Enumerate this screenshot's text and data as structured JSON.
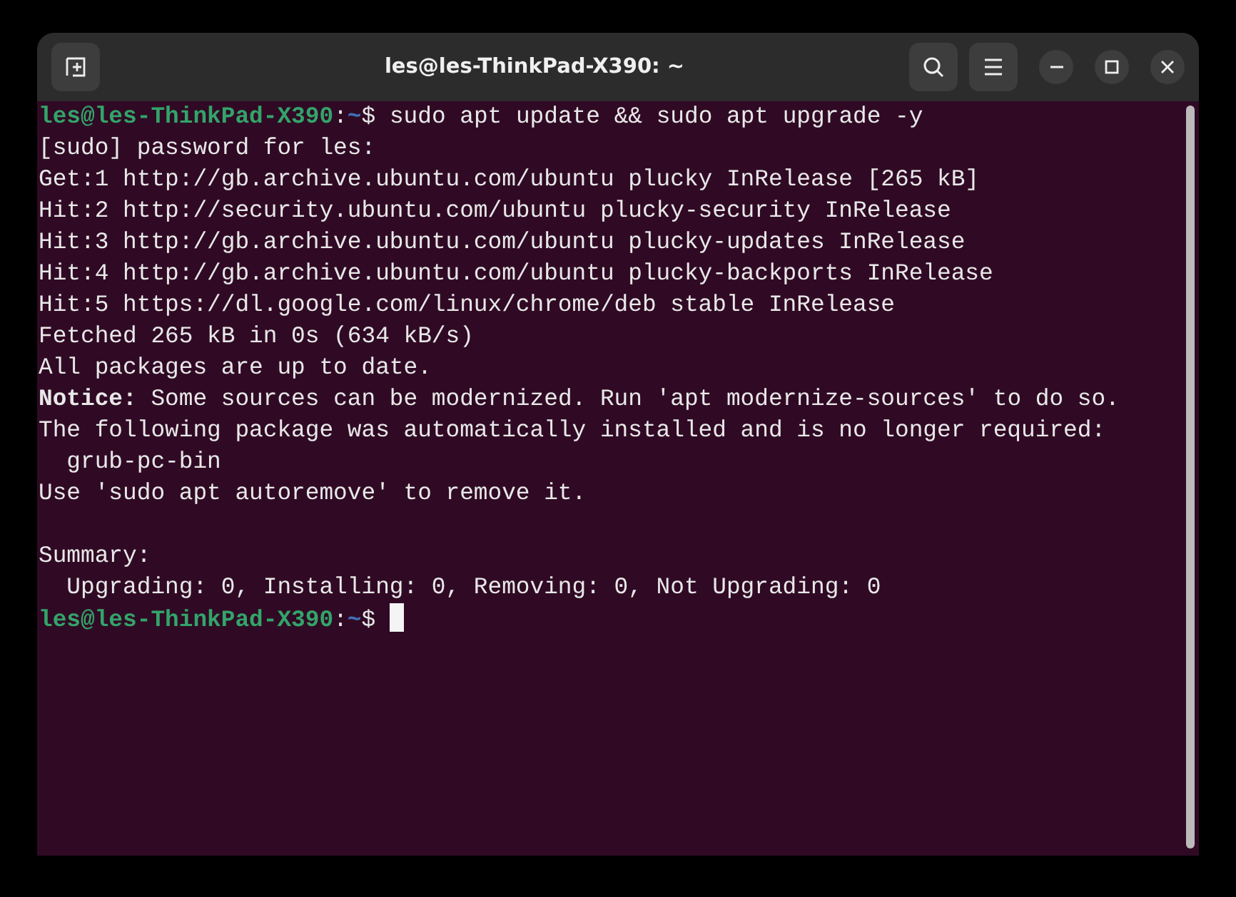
{
  "window": {
    "title": "les@les-ThinkPad-X390: ~"
  },
  "terminal": {
    "lines": [
      {
        "kind": "prompt",
        "user_host": "les@les-ThinkPad-X390",
        "separator": ":",
        "path": "~",
        "symbol": "$",
        "command": "sudo apt update && sudo apt upgrade -y",
        "cursor": false
      },
      {
        "kind": "output",
        "text": "[sudo] password for les:"
      },
      {
        "kind": "output",
        "text": "Get:1 http://gb.archive.ubuntu.com/ubuntu plucky InRelease [265 kB]"
      },
      {
        "kind": "output",
        "text": "Hit:2 http://security.ubuntu.com/ubuntu plucky-security InRelease"
      },
      {
        "kind": "output",
        "text": "Hit:3 http://gb.archive.ubuntu.com/ubuntu plucky-updates InRelease"
      },
      {
        "kind": "output",
        "text": "Hit:4 http://gb.archive.ubuntu.com/ubuntu plucky-backports InRelease"
      },
      {
        "kind": "output",
        "text": "Hit:5 https://dl.google.com/linux/chrome/deb stable InRelease"
      },
      {
        "kind": "output",
        "text": "Fetched 265 kB in 0s (634 kB/s)"
      },
      {
        "kind": "output",
        "text": "All packages are up to date."
      },
      {
        "kind": "output",
        "text": "**Notice:** Some sources can be modernized. Run 'apt modernize-sources' to do so."
      },
      {
        "kind": "output",
        "text": "The following package was automatically installed and is no longer required:"
      },
      {
        "kind": "output",
        "text": "  grub-pc-bin"
      },
      {
        "kind": "output",
        "text": "Use 'sudo apt autoremove' to remove it."
      },
      {
        "kind": "blank"
      },
      {
        "kind": "output",
        "text": "Summary:"
      },
      {
        "kind": "output",
        "text": "  Upgrading: 0, Installing: 0, Removing: 0, Not Upgrading: 0"
      },
      {
        "kind": "prompt",
        "user_host": "les@les-ThinkPad-X390",
        "separator": ":",
        "path": "~",
        "symbol": "$",
        "cursor": true
      }
    ]
  }
}
